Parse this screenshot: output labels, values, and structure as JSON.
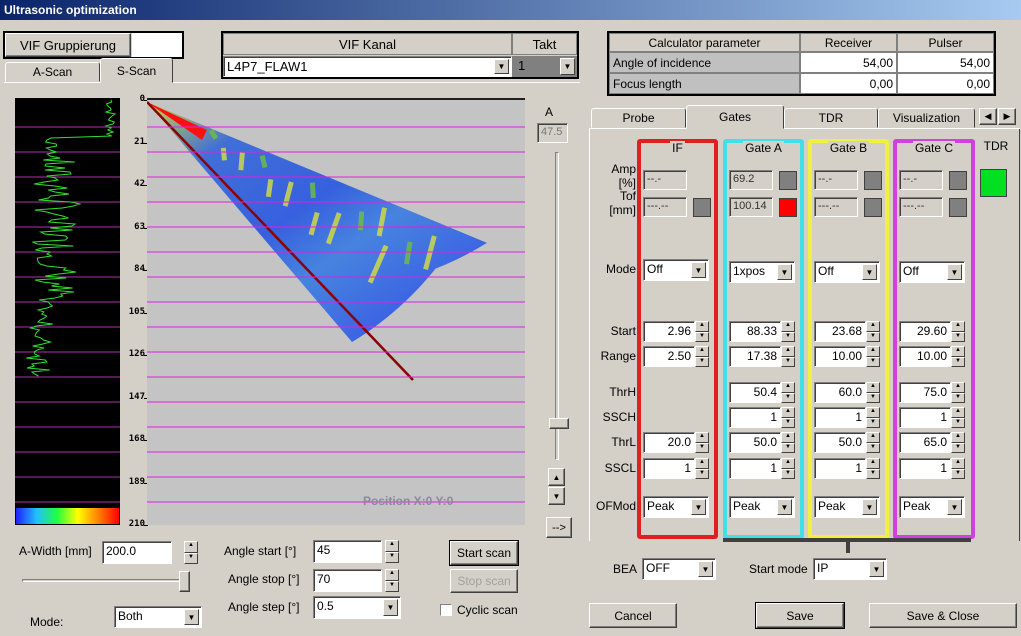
{
  "window": {
    "title": "Ultrasonic optimization"
  },
  "vif": {
    "gruppierung_label": "VIF Gruppierung",
    "gruppierung_value": "",
    "kanal_header": "VIF Kanal",
    "kanal_value": "L4P7_FLAW1",
    "takt_header": "Takt",
    "takt_value": "1"
  },
  "left_tabs": [
    {
      "label": "A-Scan"
    },
    {
      "label": "S-Scan",
      "active": true
    }
  ],
  "sscan": {
    "depth_ticks": [
      "0",
      "21",
      "42",
      "63",
      "84",
      "105",
      "126",
      "147",
      "168",
      "189",
      "210"
    ],
    "position_text": "Position X:0 Y:0",
    "beam_angle_deg": 54
  },
  "amp_slider": {
    "label": "A",
    "value": "47.5",
    "arrow_label": "-->"
  },
  "controls": {
    "awidth_label": "A-Width  [mm]",
    "awidth_value": "200.0",
    "mode_label": "Mode:",
    "mode_value": "Both",
    "angle_start_label": "Angle start [°]",
    "angle_start_value": "45",
    "angle_stop_label": "Angle stop [°]",
    "angle_stop_value": "70",
    "angle_step_label": "Angle step [°]",
    "angle_step_value": "0.5",
    "start_scan": "Start scan",
    "stop_scan": "Stop scan",
    "cyclic_label": "Cyclic scan",
    "cyclic_checked": false
  },
  "calculator": {
    "headers": [
      "Calculator parameter",
      "Receiver",
      "Pulser"
    ],
    "rows": [
      {
        "label": "Angle of incidence",
        "receiver": "54,00",
        "pulser": "54,00"
      },
      {
        "label": "Focus length",
        "receiver": "0,00",
        "pulser": "0,00"
      }
    ]
  },
  "right_tabs": [
    {
      "label": "Probe"
    },
    {
      "label": "Gates",
      "active": true
    },
    {
      "label": "TDR"
    },
    {
      "label": "Visualization"
    }
  ],
  "gates": {
    "row_labels": {
      "amp": "Amp\n[%]",
      "tof": "Tof\n[mm]",
      "mode": "Mode",
      "start": "Start",
      "range": "Range",
      "thrh": "ThrH",
      "ssch": "SSCH",
      "thrl": "ThrL",
      "sscl": "SSCL",
      "ofmod": "OFMod"
    },
    "columns": [
      {
        "name": "IF",
        "color": "#e02020",
        "amp": "--.-",
        "tof": "---.--",
        "tof_ind": "#808080",
        "mode": "Off",
        "start": "2.96",
        "range": "2.50",
        "thrl": "20.0",
        "sscl": "1",
        "ofmod": "Peak"
      },
      {
        "name": "Gate A",
        "color": "#40e0e8",
        "amp": "69.2",
        "amp_ind": "#808080",
        "tof": "100.14",
        "tof_ind": "#ff0000",
        "mode": "1xpos",
        "start": "88.33",
        "range": "17.38",
        "thrh": "50.4",
        "ssch": "1",
        "thrl": "50.0",
        "sscl": "1",
        "ofmod": "Peak"
      },
      {
        "name": "Gate B",
        "color": "#f0f040",
        "amp": "--.-",
        "amp_ind": "#808080",
        "tof": "---.--",
        "tof_ind": "#808080",
        "mode": "Off",
        "start": "23.68",
        "range": "10.00",
        "thrh": "60.0",
        "ssch": "1",
        "thrl": "50.0",
        "sscl": "1",
        "ofmod": "Peak"
      },
      {
        "name": "Gate  C",
        "color": "#d040e0",
        "amp": "--.-",
        "amp_ind": "#808080",
        "tof": "---.--",
        "tof_ind": "#808080",
        "mode": "Off",
        "start": "29.60",
        "range": "10.00",
        "thrh": "75.0",
        "ssch": "1",
        "thrl": "65.0",
        "sscl": "1",
        "ofmod": "Peak"
      }
    ],
    "tdr": {
      "label": "TDR",
      "indicator": "#00e020"
    },
    "bea_label": "BEA",
    "bea_value": "OFF",
    "start_mode_label": "Start mode",
    "start_mode_value": "IP"
  },
  "footer": {
    "cancel": "Cancel",
    "save": "Save",
    "save_close": "Save & Close"
  }
}
